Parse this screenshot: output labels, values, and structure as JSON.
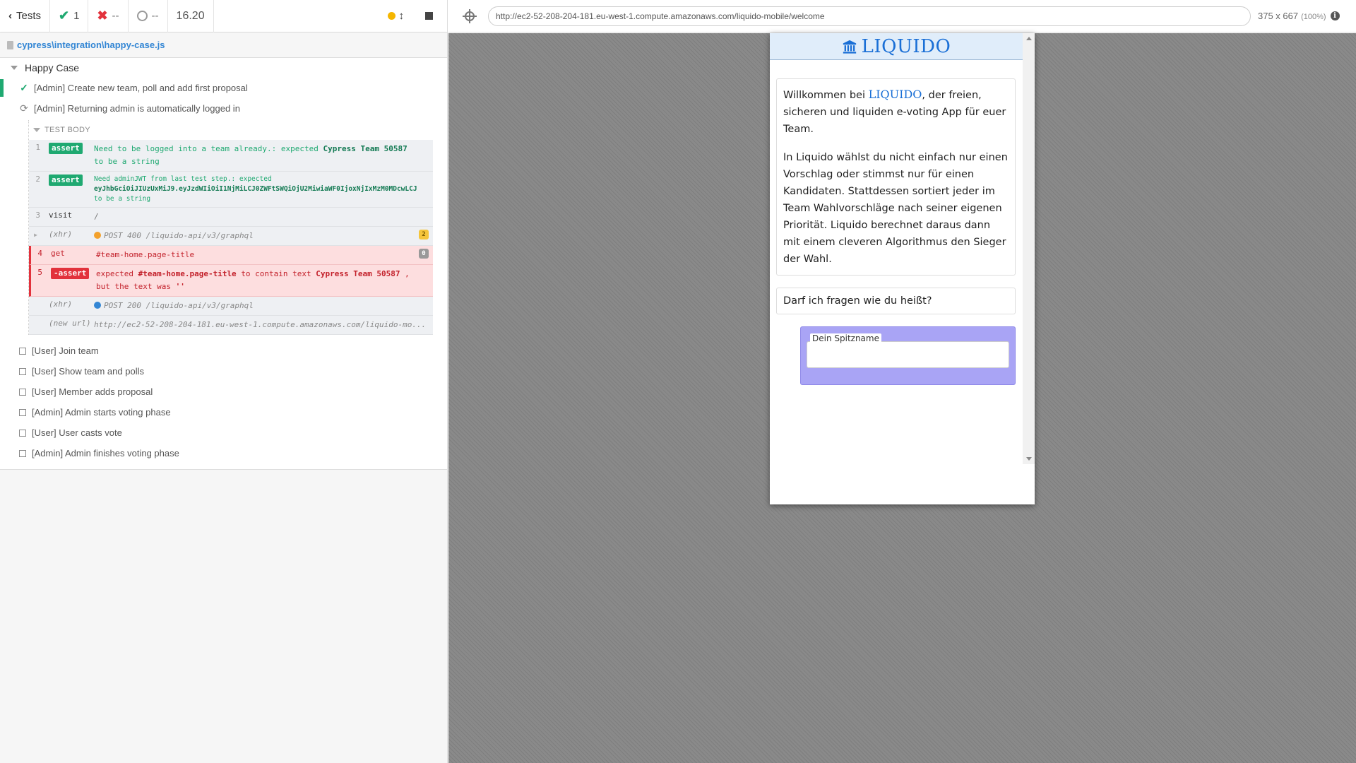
{
  "reporter": {
    "tests_label": "Tests",
    "passed_count": "1",
    "failed_count": "--",
    "pending_count": "--",
    "duration": "16.20",
    "spec_path": "cypress\\integration\\happy-case.js",
    "suite_title": "Happy Case",
    "tests": [
      {
        "label": "[Admin] Create new team, poll and add first proposal",
        "state": "passed"
      },
      {
        "label": "[Admin] Returning admin is automatically logged in",
        "state": "running"
      },
      {
        "label": "[User] Join team",
        "state": "pending"
      },
      {
        "label": "[User] Show team and polls",
        "state": "pending"
      },
      {
        "label": "[User] Member adds proposal",
        "state": "pending"
      },
      {
        "label": "[Admin] Admin starts voting phase",
        "state": "pending"
      },
      {
        "label": "[User] User casts vote",
        "state": "pending"
      },
      {
        "label": "[Admin] Admin finishes voting phase",
        "state": "pending"
      }
    ],
    "test_body_label": "TEST BODY",
    "commands": [
      {
        "num": "1",
        "name": "assert",
        "msg_a": "Need to be logged into a team already.: expected",
        "msg_b": "Cypress Team 50587",
        "msg_c": "to be a string"
      },
      {
        "num": "2",
        "name": "assert",
        "msg_a": "Need adminJWT from last test step.: expected",
        "msg_b": "eyJhbGciOiJIUzUxMiJ9.eyJzdWIiOiI1NjMiLCJ0ZWFtSWQiOjU2MiwiaWF0IjoxNjIxMzM0MDcwLCJ",
        "msg_c": "to be a string"
      },
      {
        "num": "3",
        "name": "visit",
        "msg_a": "/"
      },
      {
        "num": "",
        "name": "(xhr)",
        "msg_a": "POST 400 /liquido-api/v3/graphql",
        "badge": "2"
      },
      {
        "num": "4",
        "name": "get",
        "msg_a": "#team-home.page-title",
        "badge": "0"
      },
      {
        "num": "5",
        "name": "-assert",
        "msg_a": "expected",
        "msg_b": "#team-home.page-title",
        "msg_c": "to contain text",
        "msg_d": "Cypress Team 50587",
        "msg_e": ",",
        "msg_f": "but the text was",
        "msg_g": "''"
      },
      {
        "num": "",
        "name": "(xhr)",
        "msg_a": "POST 200 /liquido-api/v3/graphql"
      },
      {
        "num": "",
        "name": "(new url)",
        "msg_a": "http://ec2-52-208-204-181.eu-west-1.compute.amazonaws.com/liquido-mo..."
      }
    ]
  },
  "aut": {
    "url": "http://ec2-52-208-204-181.eu-west-1.compute.amazonaws.com/liquido-mobile/welcome",
    "viewport": "375 x 667",
    "zoom": "(100%)",
    "app_title": "LIQUIDO",
    "welcome_pre": "Willkommen bei",
    "welcome_brand": "LIQUIDO",
    "welcome_post": ", der freien, sicheren und liquiden e-voting App für euer Team.",
    "intro_paragraph": "In Liquido wählst du nicht einfach nur einen Vorschlag oder stimmst nur für einen Kandidaten. Stattdessen sortiert jeder im Team Wahlvorschläge nach seiner eigenen Priorität. Liquido berechnet daraus dann mit einem cleveren Algorithmus den Sieger der Wahl.",
    "question": "Darf ich fragen wie du heißt?",
    "nickname_label": "Dein Spitzname",
    "nickname_value": ""
  },
  "colors": {
    "pass": "#1fa971",
    "fail": "#e2323c",
    "accent": "#3386d4",
    "liquido_blue": "#1a6fd6",
    "nickname_bg": "#a9a4f5"
  }
}
